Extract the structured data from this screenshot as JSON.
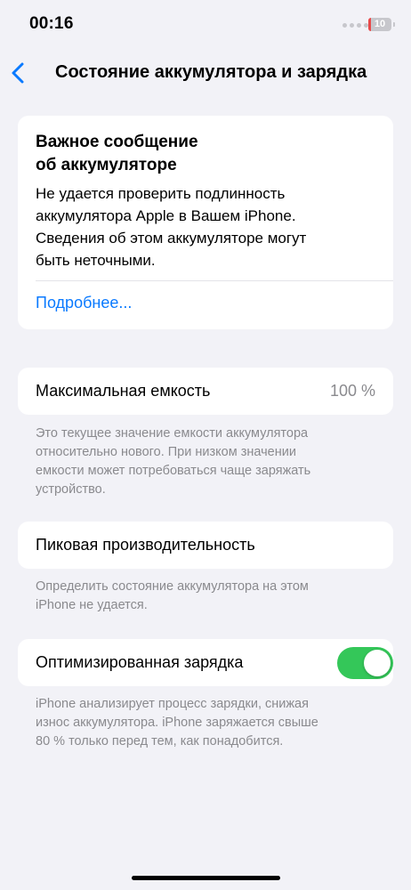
{
  "status_bar": {
    "time": "00:16",
    "battery_level": "10",
    "battery_color": "#e8494a"
  },
  "nav": {
    "back_icon": "chevron-left-icon",
    "title": "Состояние аккумулятора и зарядка"
  },
  "alert": {
    "title_line1": "Важное сообщение",
    "title_line2": "об аккумуляторе",
    "body_lines": [
      "Не удается проверить подлинность",
      "аккумулятора Apple в Вашем iPhone.",
      "Сведения об этом аккумуляторе могут",
      "быть неточными."
    ],
    "link": "Подробнее..."
  },
  "capacity": {
    "label": "Максимальная емкость",
    "value": "100 %",
    "footnote_lines": [
      "Это текущее значение емкости аккумулятора",
      "относительно нового. При низком значении",
      "емкости может потребоваться чаще заряжать",
      "устройство."
    ]
  },
  "peak": {
    "label": "Пиковая производительность",
    "footnote_lines": [
      "Определить состояние аккумулятора на этом",
      "iPhone не удается."
    ]
  },
  "optimized": {
    "label": "Оптимизированная зарядка",
    "enabled": true,
    "toggle_color": "#34c759",
    "footnote_lines": [
      "iPhone анализирует процесс зарядки, снижая",
      "износ аккумулятора. iPhone заряжается свыше",
      "80 % только перед тем, как понадобится."
    ]
  },
  "colors": {
    "background": "#f2f2f7",
    "link": "#0a7aff",
    "secondary_text": "#8a8a8e"
  }
}
